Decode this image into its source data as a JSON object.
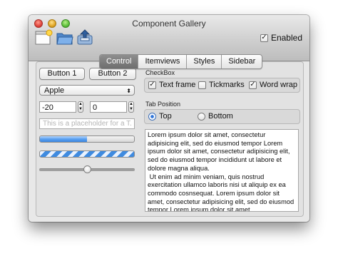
{
  "window": {
    "title": "Component Gallery"
  },
  "toolbar": {
    "tools": [
      {
        "name": "new-document-icon"
      },
      {
        "name": "open-folder-icon"
      },
      {
        "name": "save-icon"
      }
    ],
    "enabled_label": "Enabled",
    "enabled_checked": true
  },
  "tabs": [
    "Control",
    "Itemviews",
    "Styles",
    "Sidebar"
  ],
  "active_tab": "Control",
  "controls": {
    "button1": "Button 1",
    "button2": "Button 2",
    "combo_value": "Apple",
    "spin1_value": "-20",
    "spin2_value": "0",
    "placeholder": "This is a placeholder for a T...",
    "progress_value": 0.5,
    "slider_value": 0.5
  },
  "checkbox_group": {
    "title": "CheckBox",
    "items": [
      {
        "label": "Text frame",
        "checked": true
      },
      {
        "label": "Tickmarks",
        "checked": false
      },
      {
        "label": "Word wrap",
        "checked": true
      }
    ]
  },
  "tab_position": {
    "title": "Tab Position",
    "options": [
      {
        "label": "Top",
        "selected": true
      },
      {
        "label": "Bottom",
        "selected": false
      }
    ]
  },
  "text_edit": {
    "content": "Lorem ipsum dolor sit amet, consectetur adipisicing elit, sed do eiusmod tempor Lorem ipsum dolor sit amet, consectetur adipisicing elit, sed do eiusmod tempor incididunt ut labore et dolore magna aliqua.\n Ut enim ad minim veniam, quis nostrud exercitation ullamco laboris nisi ut aliquip ex ea commodo cosnsequat. Lorem ipsum dolor sit amet, consectetur adipisicing elit, sed do eiusmod tempor Lorem ipsum dolor sit amet,"
  }
}
